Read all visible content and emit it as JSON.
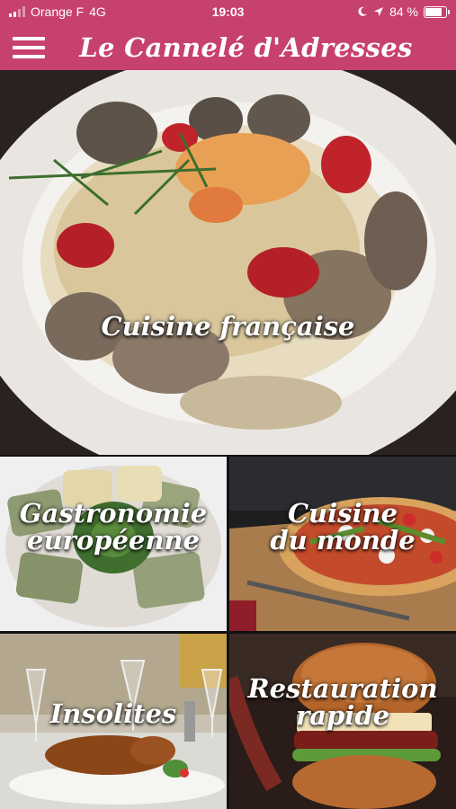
{
  "status_bar": {
    "carrier": "Orange F",
    "network": "4G",
    "time": "19:03",
    "battery": "84 %",
    "battery_level": 0.84
  },
  "header": {
    "title": "Le Cannelé d'Adresses"
  },
  "categories": [
    {
      "line1": "Cuisine française",
      "line2": ""
    },
    {
      "line1": "Gastronomie",
      "line2": "européenne"
    },
    {
      "line1": "Cuisine",
      "line2": "du monde"
    },
    {
      "line1": "Insolites",
      "line2": ""
    },
    {
      "line1": "Restauration",
      "line2": "rapide"
    }
  ],
  "colors": {
    "brand": "#c7416e"
  }
}
